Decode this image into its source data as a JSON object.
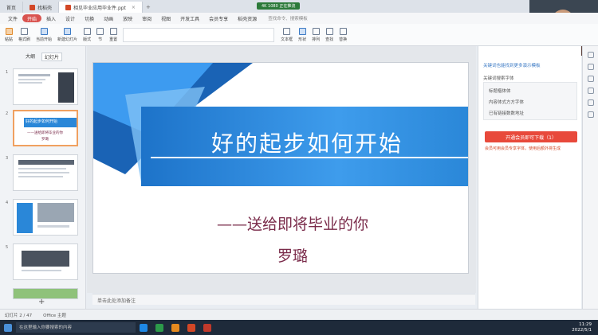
{
  "tabs": [
    {
      "label": "首页"
    },
    {
      "label": "找稻壳"
    },
    {
      "label": "相见毕业应用毕业件.ppt"
    }
  ],
  "green_badge": "4K 1080 正在推流",
  "menu": {
    "file": "文件",
    "items": [
      "开始",
      "插入",
      "设计",
      "切换",
      "动画",
      "放映",
      "审阅",
      "视图",
      "开发工具",
      "会员专享",
      "稻壳资源"
    ],
    "active": "开始",
    "search": "查找命令、搜索模板"
  },
  "ribbon": {
    "items": [
      "粘贴",
      "格式刷",
      "当前开始",
      "新建幻灯片",
      "版式",
      "节",
      "重置",
      "文本框",
      "形状",
      "排列",
      "查找",
      "替换"
    ]
  },
  "left_panel": {
    "tabs": [
      "大纲",
      "幻灯片"
    ],
    "active_tab": "幻灯片",
    "thumb2_title": "好的起步如何开始",
    "thumb2_sub": "——送给即将毕业的你",
    "thumb2_author": "罗璐",
    "add": "+"
  },
  "slide": {
    "title": "好的起步如何开始",
    "subtitle": "——送给即将毕业的你",
    "author": "罗璐"
  },
  "notes_placeholder": "单击此处添加备注",
  "right_panel": {
    "top_link": "关键词也能找到更多演示模板",
    "heading": "关键词搜索字体",
    "card_line1": "标题楷体体",
    "card_line2": "内容体式方方字体",
    "card_line3": "已有链接数数地址",
    "button": "开通会员即可下载（1）",
    "warning": "会员可用会员专享字体，使用后额外将生成"
  },
  "status": {
    "left": "幻灯片 2 / 47",
    "theme": "Office 主题"
  },
  "taskbar": {
    "search": "在这里输入你要搜索的内容",
    "time": "11:29",
    "date": "2022/5/1"
  },
  "colors": {
    "accent": "#d9534f",
    "slide_blue": "#2a87d8",
    "title_text": "#ffffff",
    "subtitle_text": "#7a2b4a",
    "vip_button": "#e8493b"
  }
}
